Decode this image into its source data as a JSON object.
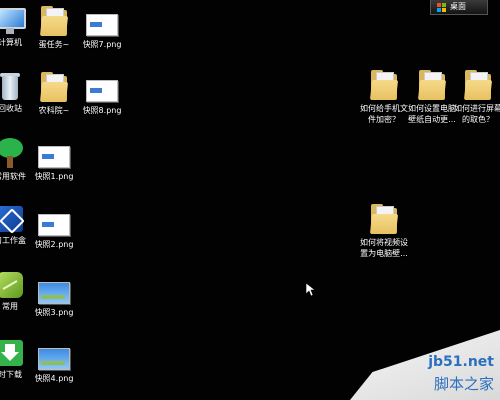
{
  "taskbar": {
    "desktop_button_label": "桌面"
  },
  "icons": {
    "computer": "计算机",
    "egg_task": "蛋任务~",
    "shot7": "快照7.png",
    "recycle": "回收站",
    "ag_academy": "农科院~",
    "shot8": "快照8.png",
    "common_software": "常用软件",
    "shot1": "快照1.png",
    "workbench": "习工作盒",
    "shot2": "快照2.png",
    "common": "常用",
    "shot3": "快照3.png",
    "downloader": "时下载",
    "shot4": "快照4.png",
    "folder_phone_encrypt": "如何给手机文件加密？",
    "folder_wallpaper_auto": "如何设置电脑壁纸自动更...",
    "folder_screen_color": "如何进行屏幕的取色？",
    "folder_video_wallpaper": "如何将视频设置为电脑壁..."
  },
  "watermark": {
    "site": "jb51.net",
    "brand": "脚本之家"
  },
  "colors": {
    "desktop_bg": "#020202",
    "folder": "#e7c160",
    "watermark_text": "#2b6fbf"
  }
}
